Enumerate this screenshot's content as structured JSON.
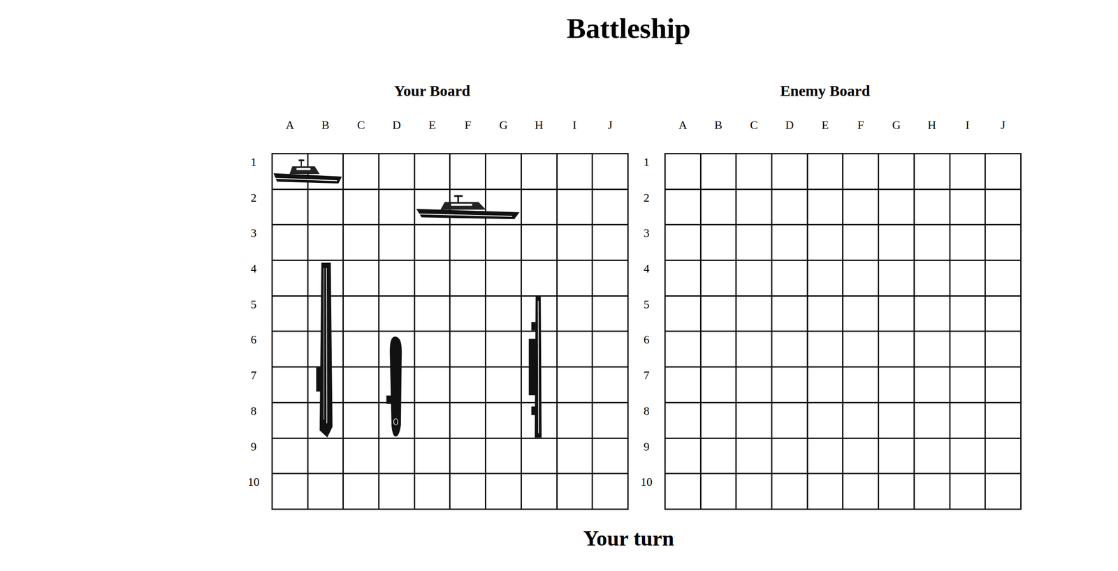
{
  "title": "Battleship",
  "boards": [
    {
      "title": "Your Board",
      "columns": [
        "A",
        "B",
        "C",
        "D",
        "E",
        "F",
        "G",
        "H",
        "I",
        "J"
      ],
      "rows": [
        "1",
        "2",
        "3",
        "4",
        "5",
        "6",
        "7",
        "8",
        "9",
        "10"
      ],
      "ships": [
        {
          "kind": "gunboat",
          "column": "A",
          "row": "1",
          "length": 2,
          "vertical": false
        },
        {
          "kind": "gunboat",
          "column": "E",
          "row": "2",
          "length": 3,
          "vertical": false
        },
        {
          "kind": "carrier",
          "column": "B",
          "row": "4",
          "length": 5,
          "vertical": true
        },
        {
          "kind": "submarine",
          "column": "D",
          "row": "6",
          "length": 3,
          "vertical": true
        },
        {
          "kind": "battleship",
          "column": "H",
          "row": "5",
          "length": 4,
          "vertical": true
        }
      ]
    },
    {
      "title": "Enemy Board",
      "columns": [
        "A",
        "B",
        "C",
        "D",
        "E",
        "F",
        "G",
        "H",
        "I",
        "J"
      ],
      "rows": [
        "1",
        "2",
        "3",
        "4",
        "5",
        "6",
        "7",
        "8",
        "9",
        "10"
      ],
      "ships": []
    }
  ],
  "status": "Your turn"
}
